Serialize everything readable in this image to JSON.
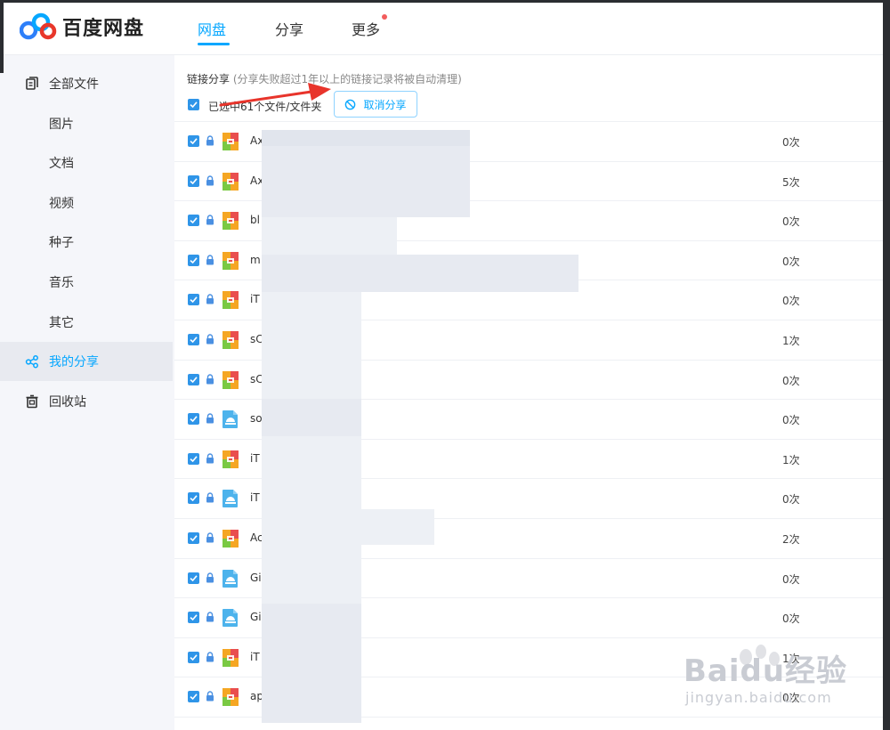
{
  "header": {
    "brand": "百度网盘",
    "tabs": [
      {
        "label": "网盘",
        "active": true
      },
      {
        "label": "分享",
        "active": false
      },
      {
        "label": "更多",
        "active": false,
        "has_dot": true
      }
    ]
  },
  "sidebar": {
    "items": [
      {
        "label": "全部文件",
        "icon": "all-files-icon",
        "active": false
      },
      {
        "label": "图片",
        "active": false
      },
      {
        "label": "文档",
        "active": false
      },
      {
        "label": "视频",
        "active": false
      },
      {
        "label": "种子",
        "active": false
      },
      {
        "label": "音乐",
        "active": false
      },
      {
        "label": "其它",
        "active": false
      },
      {
        "label": "我的分享",
        "icon": "share-icon",
        "active": true
      },
      {
        "label": "回收站",
        "icon": "trash-icon",
        "active": false
      }
    ]
  },
  "toolbar": {
    "title": "链接分享",
    "note": "(分享失败超过1年以上的链接记录将被自动清理)",
    "selected_text": "已选中61个文件/文件夹",
    "cancel_label": "取消分享"
  },
  "files": [
    {
      "name": "Ax",
      "type": "archive",
      "count": "0次"
    },
    {
      "name": "Ax",
      "type": "archive",
      "count": "5次"
    },
    {
      "name": "bl",
      "type": "archive",
      "count": "0次"
    },
    {
      "name": "m",
      "type": "archive",
      "count": "0次"
    },
    {
      "name": "iT",
      "type": "archive",
      "count": "0次"
    },
    {
      "name": "sC",
      "type": "archive",
      "count": "1次"
    },
    {
      "name": "sC",
      "type": "archive",
      "count": "0次"
    },
    {
      "name": "so",
      "type": "app",
      "count": "0次"
    },
    {
      "name": "iT",
      "type": "archive",
      "count": "1次"
    },
    {
      "name": "iT",
      "type": "app",
      "count": "0次"
    },
    {
      "name": "Ac",
      "type": "archive",
      "count": "2次"
    },
    {
      "name": "Gi",
      "type": "app",
      "count": "0次"
    },
    {
      "name": "Gi",
      "type": "app",
      "count": "0次"
    },
    {
      "name": "iT",
      "type": "archive",
      "count": "1次"
    },
    {
      "name": "ap",
      "type": "archive",
      "count": "0次"
    }
  ],
  "watermark": {
    "brand": "Baidu经验",
    "url": "jingyan.baidu.com"
  },
  "colors": {
    "accent": "#06a7ff",
    "checkbox": "#2f95e8",
    "arrow": "#e8342b"
  }
}
